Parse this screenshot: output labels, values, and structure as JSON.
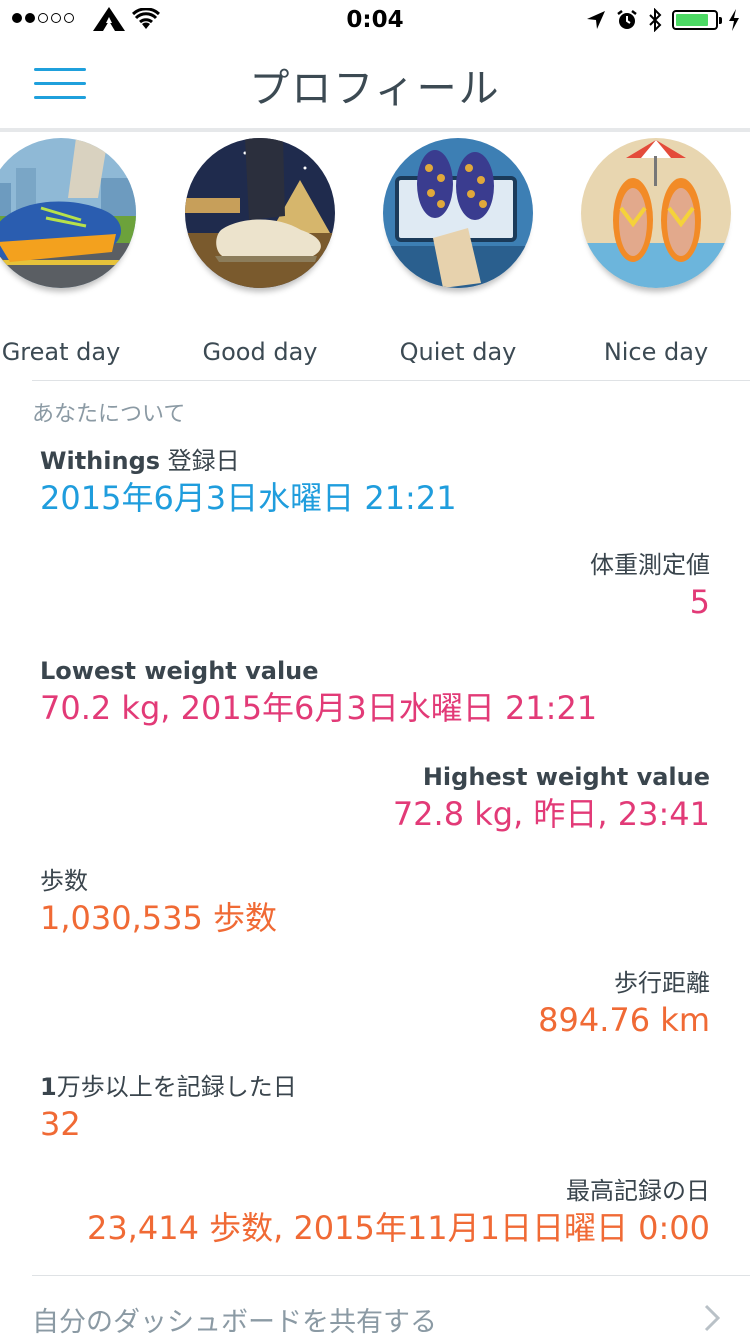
{
  "status_bar": {
    "time": "0:04",
    "signal_dots": [
      true,
      true,
      false,
      false,
      false
    ],
    "battery_level": 0.85
  },
  "nav": {
    "title": "プロフィール",
    "menu_icon": "hamburger-menu-icon",
    "accent_color": "#1fa0dc"
  },
  "moods": [
    {
      "label": "Great day",
      "icon": "running-shoe-illustration"
    },
    {
      "label": "Good day",
      "icon": "dress-shoe-illustration"
    },
    {
      "label": "Quiet day",
      "icon": "slippers-tv-illustration"
    },
    {
      "label": "Nice day",
      "icon": "flip-flops-beach-illustration"
    }
  ],
  "about": {
    "section_title": "あなたについて",
    "registration": {
      "label_bold": "Withings",
      "label_rest": " 登録日",
      "value": "2015年6月3日水曜日 21:21"
    },
    "weight_count": {
      "label": "体重測定値",
      "value": "5"
    },
    "lowest_weight": {
      "label": "Lowest weight value",
      "value": "70.2 kg, 2015年6月3日水曜日 21:21"
    },
    "highest_weight": {
      "label": "Highest weight value",
      "value": "72.8 kg, 昨日, 23:41"
    },
    "steps": {
      "label": "歩数",
      "value": "1,030,535 歩数"
    },
    "distance": {
      "label": "歩行距離",
      "value": "894.76 km"
    },
    "days_10k": {
      "label_bold": "1",
      "label_rest": "万歩以上を記録した日",
      "value": "32"
    },
    "best_day": {
      "label": "最高記録の日",
      "value": "23,414 歩数, 2015年11月1日日曜日 0:00"
    }
  },
  "share": {
    "label": "自分のダッシュボードを共有する",
    "icon": "chevron-right-icon"
  },
  "colors": {
    "blue": "#1f9ddd",
    "pink": "#e23a77",
    "orange": "#f06a35",
    "text": "#3c4a53",
    "muted": "#8b9aa4"
  }
}
